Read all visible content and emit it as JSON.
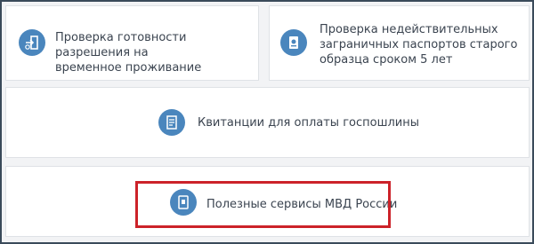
{
  "cards": {
    "permit": {
      "icon": "exit-arrow-icon",
      "line1": "Проверка готовности разрешения на",
      "line2": "временное проживание"
    },
    "passport": {
      "icon": "passport-icon",
      "line1": "Проверка недействительных",
      "line2": "заграничных паспортов старого",
      "line3": "образца сроком 5 лет"
    },
    "receipts": {
      "icon": "receipt-list-icon",
      "line1": "Квитанции для оплаты госпошлины"
    },
    "services": {
      "icon": "id-card-icon",
      "line1": "Полезные сервисы МВД России"
    }
  },
  "colors": {
    "accent": "#4a86bd",
    "highlight": "#cc2229",
    "background": "#f2f3f5",
    "card": "#ffffff"
  }
}
